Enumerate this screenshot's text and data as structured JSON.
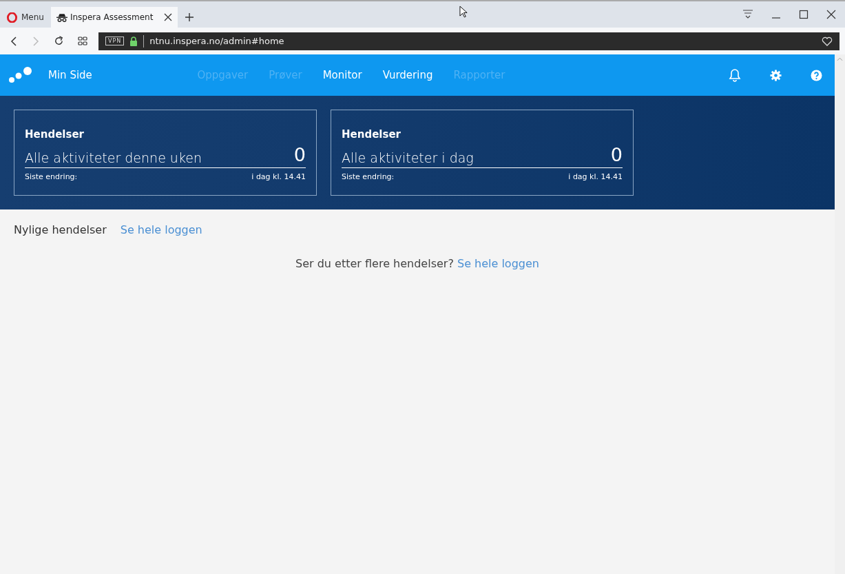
{
  "browser": {
    "menu_label": "Menu",
    "tabs": [
      {
        "title": "Inspera Assessment",
        "selected": true
      }
    ],
    "url": "ntnu.inspera.no/admin#home",
    "vpn_badge": "VPN"
  },
  "app_bar": {
    "title": "Min Side",
    "nav": [
      {
        "label": "Oppgaver",
        "disabled": true
      },
      {
        "label": "Prøver",
        "disabled": true
      },
      {
        "label": "Monitor",
        "disabled": false
      },
      {
        "label": "Vurdering",
        "disabled": false
      },
      {
        "label": "Rapporter",
        "disabled": true
      }
    ]
  },
  "cards": [
    {
      "heading": "Hendelser",
      "label": "Alle aktiviteter denne uken",
      "count": "0",
      "footer_label": "Siste endring:",
      "footer_value": "i dag kl. 14.41"
    },
    {
      "heading": "Hendelser",
      "label": "Alle aktiviteter i dag",
      "count": "0",
      "footer_label": "Siste endring:",
      "footer_value": "i dag kl. 14.41"
    }
  ],
  "recent": {
    "title": "Nylige hendelser",
    "link": "Se hele loggen",
    "empty_text": "Ser du etter flere hendelser?",
    "empty_link": "Se hele loggen"
  }
}
